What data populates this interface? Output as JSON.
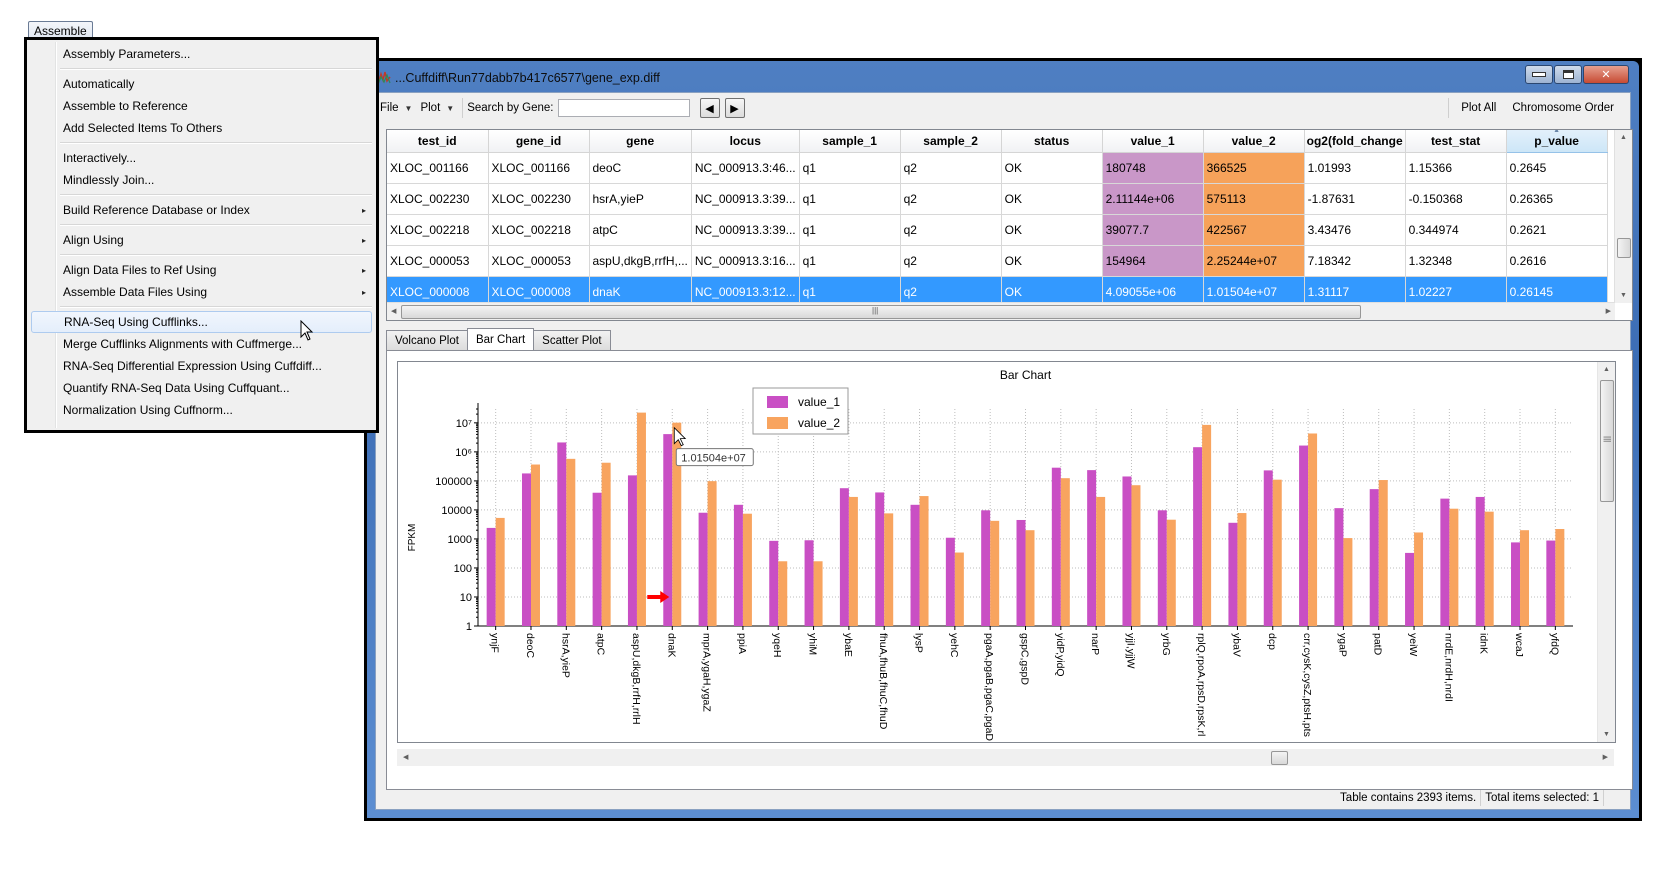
{
  "assemble_menu": {
    "title": "Assemble",
    "items": [
      {
        "label": "Assembly Parameters...",
        "submenu": false
      },
      {
        "label": "Automatically",
        "submenu": false
      },
      {
        "label": "Assemble to Reference",
        "submenu": false
      },
      {
        "label": "Add Selected Items To Others",
        "submenu": false
      },
      {
        "label": "Interactively...",
        "submenu": false
      },
      {
        "label": "Mindlessly Join...",
        "submenu": false
      },
      {
        "label": "Build Reference Database or Index",
        "submenu": true
      },
      {
        "label": "Align Using",
        "submenu": true
      },
      {
        "label": "Align Data Files to Ref Using",
        "submenu": true
      },
      {
        "label": "Assemble Data Files Using",
        "submenu": true
      },
      {
        "label": "RNA-Seq Using Cufflinks...",
        "submenu": false,
        "highlighted": true
      },
      {
        "label": "Merge Cufflinks Alignments with Cuffmerge...",
        "submenu": false
      },
      {
        "label": "RNA-Seq Differential Expression Using Cuffdiff...",
        "submenu": false
      },
      {
        "label": "Quantify RNA-Seq Data Using Cuffquant...",
        "submenu": false
      },
      {
        "label": "Normalization Using Cuffnorm...",
        "submenu": false
      }
    ],
    "submenu_arrow": "▸"
  },
  "window": {
    "title": "...Cuffdiff\\Run77dabb7b417c6577\\gene_exp.diff",
    "buttons": {
      "minimize": "minimize",
      "maximize": "maximize",
      "close": "✕"
    }
  },
  "toolbar": {
    "file_label": "File",
    "plot_label": "Plot",
    "dropdown_arrow": "▼",
    "search_label": "Search by Gene:",
    "search_value": "",
    "prev_icon": "◀",
    "next_icon": "▶",
    "plot_all_label": "Plot All",
    "chromosome_order_label": "Chromosome Order"
  },
  "table": {
    "columns": [
      "test_id",
      "gene_id",
      "gene",
      "locus",
      "sample_1",
      "sample_2",
      "status",
      "value_1",
      "value_2",
      "og2(fold_change",
      "test_stat",
      "p_value"
    ],
    "sorted_column": "p_value",
    "sort_caret": "▲",
    "rows": [
      {
        "cells": [
          "XLOC_001166",
          "XLOC_001166",
          "deoC",
          "NC_000913.3:46...",
          "q1",
          "q2",
          "OK",
          "180748",
          "366525",
          "1.01993",
          "1.15366",
          "0.2645"
        ],
        "selected": false
      },
      {
        "cells": [
          "XLOC_002230",
          "XLOC_002230",
          "hsrA,yieP",
          "NC_000913.3:39...",
          "q1",
          "q2",
          "OK",
          "2.11144e+06",
          "575113",
          "-1.87631",
          "-0.150368",
          "0.26365"
        ],
        "selected": false
      },
      {
        "cells": [
          "XLOC_002218",
          "XLOC_002218",
          "atpC",
          "NC_000913.3:39...",
          "q1",
          "q2",
          "OK",
          "39077.7",
          "422567",
          "3.43476",
          "0.344974",
          "0.2621"
        ],
        "selected": false
      },
      {
        "cells": [
          "XLOC_000053",
          "XLOC_000053",
          "aspU,dkgB,rrfH,...",
          "NC_000913.3:16...",
          "q1",
          "q2",
          "OK",
          "154964",
          "2.25244e+07",
          "7.18342",
          "1.32348",
          "0.2616"
        ],
        "selected": false
      },
      {
        "cells": [
          "XLOC_000008",
          "XLOC_000008",
          "dnaK",
          "NC_000913.3:12...",
          "q1",
          "q2",
          "OK",
          "4.09055e+06",
          "1.01504e+07",
          "1.31117",
          "1.02227",
          "0.26145"
        ],
        "selected": true
      }
    ],
    "colors": {
      "value_1_cell": "#c997c8",
      "value_2_cell": "#f6a25a",
      "selected_row": "#3399ff"
    }
  },
  "tabs": [
    {
      "label": "Volcano Plot",
      "active": false
    },
    {
      "label": "Bar Chart",
      "active": true
    },
    {
      "label": "Scatter Plot",
      "active": false
    }
  ],
  "tooltip": {
    "text": "1.01504e+07"
  },
  "status": {
    "table_count": "Table contains 2393 items.",
    "selected_count": "Total items selected: 1"
  },
  "chart_data": {
    "type": "bar",
    "title": "Bar Chart",
    "xlabel": "",
    "ylabel": "FPKM",
    "yscale": "log",
    "ylim": [
      1,
      30000000
    ],
    "yticks": [
      {
        "value": 1,
        "label": "1"
      },
      {
        "value": 10,
        "label": "10"
      },
      {
        "value": 100,
        "label": "100"
      },
      {
        "value": 1000,
        "label": "1000"
      },
      {
        "value": 10000,
        "label": "10000"
      },
      {
        "value": 100000,
        "label": "100000"
      },
      {
        "value": 1000000,
        "label": "10⁶"
      },
      {
        "value": 10000000,
        "label": "10⁷"
      }
    ],
    "grid": true,
    "legend_position": "top-center",
    "categories": [
      "ynjF",
      "deoC",
      "hsrA,yieP",
      "atpC",
      "aspU,dkgB,rrfH,rrlH",
      "dnaK",
      "mprA,ygaH,ygaZ",
      "ppiA",
      "yqeH",
      "yhiM",
      "ybaE",
      "fhuA,fhuB,fhuC,fhuD",
      "lysP",
      "yehC",
      "pgaA,pgaB,pgaC,pgaD",
      "gspC,gspD",
      "yidP,yidQ",
      "narP",
      "yjjI,yjjW",
      "yrbG",
      "rplQ,rpoA,rpsD,rpsK,rl",
      "ybaV",
      "dcp",
      "crr,cysK,cysZ,ptsH,pts",
      "ygaP",
      "patD",
      "yeiW",
      "nrdE,nrdH,nrdI",
      "idnK",
      "wcaJ",
      "yfdQ"
    ],
    "series": [
      {
        "name": "value_1",
        "color": "#c94fc4",
        "values": [
          2400,
          180748,
          2111440,
          39077.7,
          154964,
          4090550,
          8000,
          15000,
          860,
          900,
          56000,
          40000,
          15000,
          1100,
          9700,
          4500,
          285000,
          235000,
          142000,
          9700,
          1450000,
          3600,
          230000,
          1650000,
          11500,
          52000,
          330,
          24500,
          28000,
          760,
          880
        ]
      },
      {
        "name": "value_2",
        "color": "#f8a45f",
        "values": [
          5300,
          366525,
          575113,
          422567,
          22524400,
          10150400,
          98000,
          7400,
          170,
          170,
          28000,
          7600,
          30000,
          340,
          4200,
          2000,
          124000,
          28000,
          71000,
          4600,
          8500000,
          7800,
          110000,
          4300000,
          1070,
          107000,
          1670,
          11000,
          8700,
          2000,
          2200
        ]
      }
    ],
    "annotations": [
      {
        "type": "arrow",
        "color": "#ff0000",
        "target_category": "dnaK",
        "at_value": 10
      },
      {
        "type": "tooltip",
        "target_category": "dnaK",
        "series": "value_2",
        "text": "1.01504e+07"
      }
    ]
  }
}
